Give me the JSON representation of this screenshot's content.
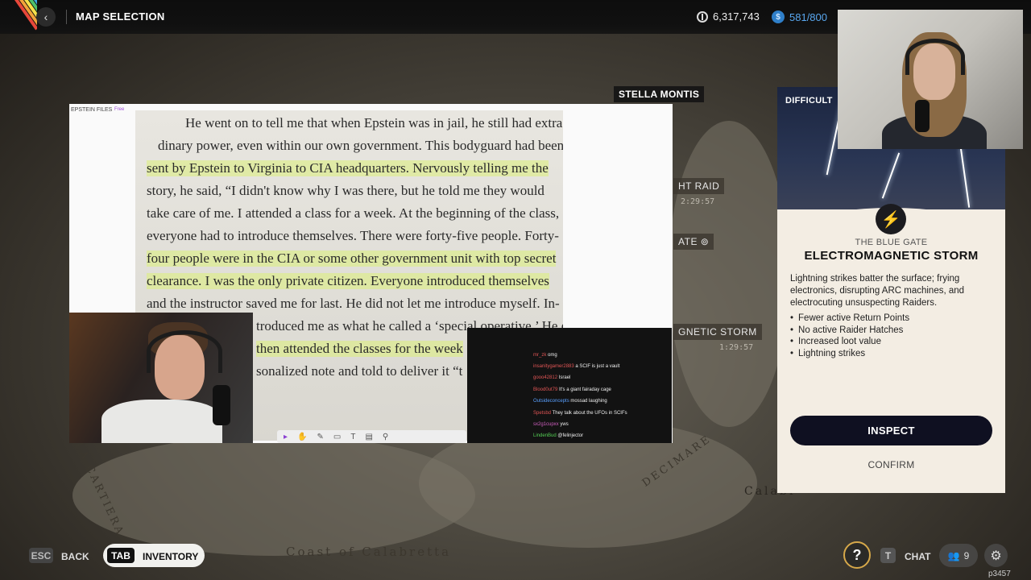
{
  "header": {
    "title": "MAP SELECTION",
    "coins": "6,317,743",
    "capacity": "581/800"
  },
  "map": {
    "selected_location": "STELLA MONTIS",
    "events": [
      {
        "label": "HT RAID",
        "time": "2:29:57"
      },
      {
        "label": "ATE",
        "time": ""
      },
      {
        "label": "GNETIC STORM",
        "time": "1:29:57"
      }
    ],
    "labels": [
      "LA CARTIERA",
      "DECIMARE",
      "Coast of Calabretta",
      "Calabr"
    ]
  },
  "panel": {
    "difficulty_label": "DIFFICULT",
    "map_name": "THE BLUE GATE",
    "event_name": "ELECTROMAGNETIC STORM",
    "description": "Lightning strikes batter the surface; frying electronics, disrupting ARC machines, and electrocuting unsuspecting Raiders.",
    "modifiers": [
      "Fewer active Return Points",
      "No active Raider Hatches",
      "Increased loot value",
      "Lightning strikes"
    ],
    "inspect_label": "INSPECT",
    "confirm_label": "CONFIRM"
  },
  "document": {
    "tab_title": "EPSTEIN FILES",
    "tab_badge": "Free",
    "lines": [
      "He went on to tell me that when Epstein was in jail, he still had extraor-",
      "dinary power, even within our own government. This bodyguard had been",
      "sent by Epstein to Virginia to CIA headquarters. Nervously telling me the",
      "story, he said, “I didn't know why I was there, but he told me they would",
      "take care of me. I attended a class for a week. At the beginning of the class,",
      "everyone had to introduce themselves. There were forty-five people. Forty-",
      "four people were in the CIA or some other government unit with top secret",
      "clearance. I was the only private citizen. Everyone introduced themselves",
      "and the instructor saved me for last. He did not let me introduce myself. In-",
      "troduced me as what he called a ‘special operative.’ He e",
      "then attended the classes for the week",
      "sonalized note and told to deliver it “t"
    ]
  },
  "chat": [
    {
      "user": "mr_zk",
      "text": "omg",
      "color": "#e05555"
    },
    {
      "user": "insanitygamer2883",
      "text": "a SCIF is just a vault",
      "color": "#e05555"
    },
    {
      "user": "gooo42812",
      "text": "Israel",
      "color": "#e05555"
    },
    {
      "user": "Blood0ut79",
      "text": "It's a giant fairaday cage",
      "color": "#e05555"
    },
    {
      "user": "Outsideconcepts",
      "text": "mossad laughing",
      "color": "#5aa0ff"
    },
    {
      "user": "Spetsbd",
      "text": "They talk about the UFOs in SCIFs",
      "color": "#e05555"
    },
    {
      "user": "sx2g1cupxx",
      "text": "yws",
      "color": "#d060c0"
    },
    {
      "user": "LindenBud",
      "text": "@felinjector",
      "color": "#55d055"
    }
  ],
  "footer": {
    "esc_key": "ESC",
    "back_label": "BACK",
    "tab_key": "TAB",
    "inventory_label": "INVENTORY",
    "help_glyph": "?",
    "chat_key": "T",
    "chat_label": "CHAT",
    "friends_count": "9",
    "build_id": "p3457"
  }
}
